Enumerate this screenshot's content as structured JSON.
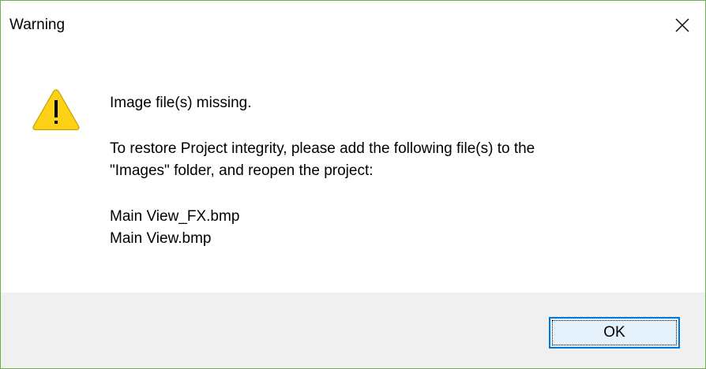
{
  "window": {
    "title": "Warning",
    "border_color": "#6fae4f"
  },
  "titlebar": {
    "close_icon": "close-icon"
  },
  "message": {
    "icon": "warning-icon",
    "heading": "Image file(s) missing.",
    "body_lines": [
      "To restore Project integrity, please add the following file(s) to the",
      "\"Images\" folder, and reopen the project:"
    ],
    "files": [
      "Main View_FX.bmp",
      "Main View.bmp"
    ]
  },
  "footer": {
    "ok_label": "OK",
    "ok_border_color": "#0078d7",
    "background": "#f0f0f0"
  }
}
